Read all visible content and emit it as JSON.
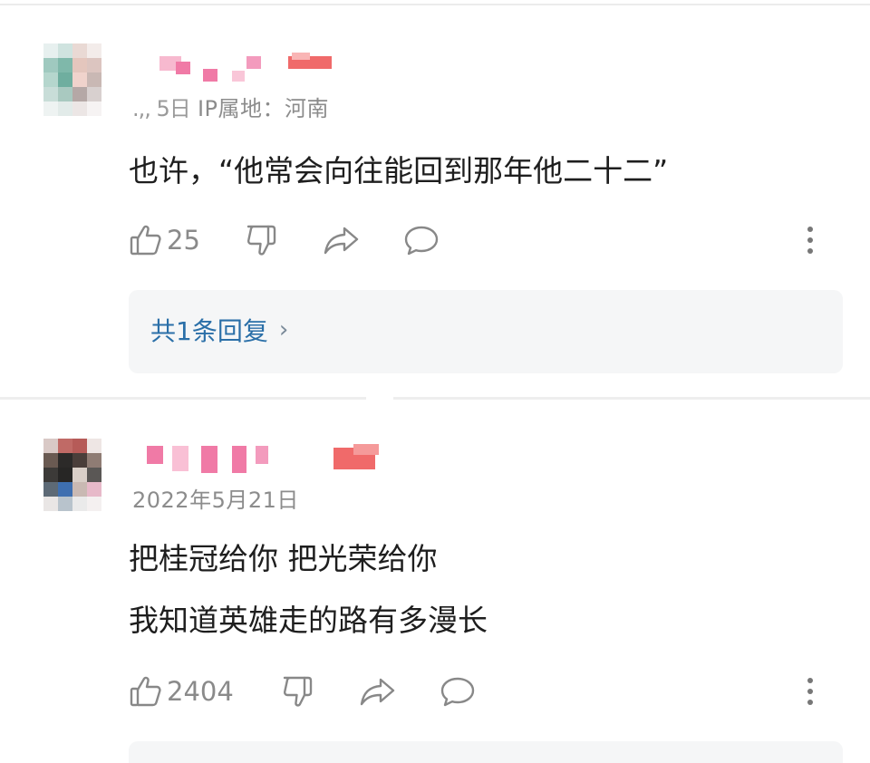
{
  "comments": [
    {
      "meta_cut": ".,, 5日",
      "meta_ip": "IP属地：河南",
      "lines": [
        "也许，“他常会向往能回到那年他二十二”"
      ],
      "likes": "25",
      "reply_label": "共1条回复"
    },
    {
      "meta_cut": "2022年5月21日",
      "meta_ip": "",
      "lines": [
        "把桂冠给你 把光荣给你",
        "我知道英雄走的路有多漫长"
      ],
      "likes": "2404",
      "reply_label": ""
    }
  ],
  "icons": {
    "like": "thumbs-up-icon",
    "dislike": "thumbs-down-icon",
    "share": "share-arrow-icon",
    "reply": "speech-bubble-icon",
    "more": "more-vertical-icon"
  },
  "colors": {
    "reply_link": "#2a6fa8",
    "meta_gray": "#8c8c8c",
    "reply_box_bg": "#f5f6f7"
  }
}
